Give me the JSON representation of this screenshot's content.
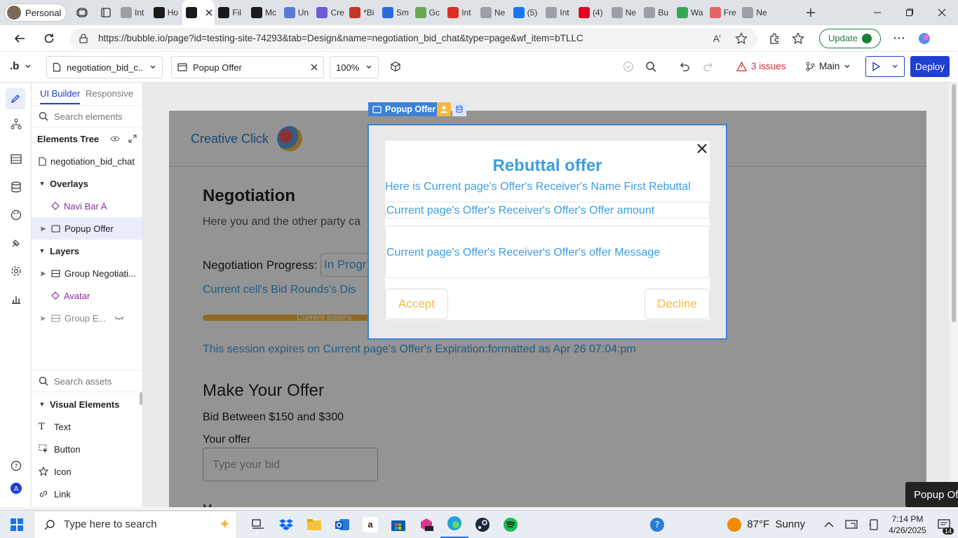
{
  "browser": {
    "profile": "Personal",
    "tabs": [
      {
        "label": "Int",
        "color": "#9aa0a6"
      },
      {
        "label": "Ho",
        "color": "#1a1a1a"
      },
      {
        "label": "",
        "color": "#1a1a1a"
      },
      {
        "label": "Fil",
        "color": "#1a1a1a"
      },
      {
        "label": "Mc",
        "color": "#1a1a1a"
      },
      {
        "label": "Un",
        "color": "#5b7bd5"
      },
      {
        "label": "Cre",
        "color": "#6b5bd5"
      },
      {
        "label": "*Bi",
        "color": "#c0392b"
      },
      {
        "label": "Sm",
        "color": "#2a6ad8"
      },
      {
        "label": "Gc",
        "color": "#6aa84f"
      },
      {
        "label": "Int",
        "color": "#d93025"
      },
      {
        "label": "Ne",
        "color": "#9aa0a6"
      },
      {
        "label": "(5)",
        "color": "#1877f2"
      },
      {
        "label": "Int",
        "color": "#9aa0a6"
      },
      {
        "label": "(4)",
        "color": "#e60023"
      },
      {
        "label": "Ne",
        "color": "#9aa0a6"
      },
      {
        "label": "Bu",
        "color": "#9aa0a6"
      },
      {
        "label": "Wa",
        "color": "#34a853"
      },
      {
        "label": "Fre",
        "color": "#e06666"
      },
      {
        "label": "Ne",
        "color": "#9aa0a6"
      }
    ],
    "url": "https://bubble.io/page?id=testing-site-74293&tab=Design&name=negotiation_bid_chat&type=page&wf_item=bTLLC",
    "update_label": "Update"
  },
  "toolbar": {
    "logo": ".b",
    "page_select": "negotiation_bid_c...",
    "element_select": "Popup Offer",
    "zoom": "100%",
    "issues": "3 issues",
    "branch": "Main",
    "deploy": "Deploy"
  },
  "panel": {
    "tab_ui_builder": "UI Builder",
    "tab_responsive": "Responsive",
    "search_elements": "Search elements",
    "elements_tree": "Elements Tree",
    "root_page": "negotiation_bid_chat",
    "overlays": "Overlays",
    "overlay_items": [
      "Navi Bar A",
      "Popup Offer"
    ],
    "layers": "Layers",
    "layer_items": [
      "Group Negotiati...",
      "Avatar",
      "Group E..."
    ],
    "search_assets": "Search assets",
    "visual_elements": "Visual Elements",
    "visual_items": [
      "Text",
      "Button",
      "Icon",
      "Link"
    ]
  },
  "page": {
    "brand": "Creative Click",
    "heading": "Negotiation",
    "subtext": "Here you and the other party ca",
    "progress_label": "Negotiation Progress:",
    "progress_value": "In Progr",
    "bid_rounds": "Current cell's Bid Rounds's Dis",
    "bar_text": "Current page's",
    "expires": "This session expires on Current page's Offer's Expiration:formatted as Apr 26 07:04:pm",
    "make_offer": "Make Your Offer",
    "bid_between": "Bid Between $150 and $300",
    "your_offer": "Your offer",
    "bid_placeholder": "Type your bid",
    "cut_label": "M"
  },
  "popup": {
    "tag": "Popup Offer",
    "title": "Rebuttal offer",
    "line1": "Here is Current page's Offer's Receiver's Name First Rebuttal",
    "amount": "Current page's Offer's Receiver's Offer's Offer amount",
    "message": "Current page's Offer's Receiver's Offer's offer Message",
    "accept": "Accept",
    "decline": "Decline"
  },
  "tooltip": "Popup Offer",
  "taskbar": {
    "search_placeholder": "Type here to search",
    "weather": "87°F  Sunny",
    "time": "7:14 PM",
    "date": "4/26/2025",
    "notifications": "14"
  }
}
